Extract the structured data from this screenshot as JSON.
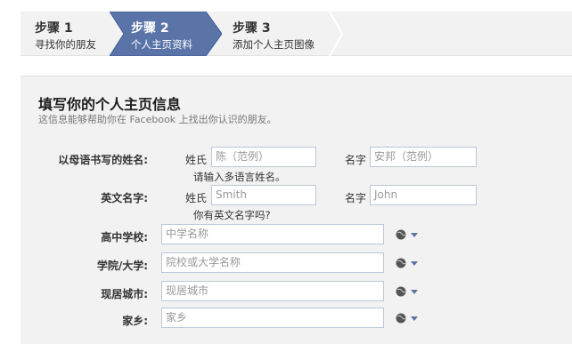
{
  "steps": [
    {
      "title": "步骤 1",
      "subtitle": "寻找你的朋友"
    },
    {
      "title": "步骤 2",
      "subtitle": "个人主页资料"
    },
    {
      "title": "步骤 3",
      "subtitle": "添加个人主页图像"
    }
  ],
  "colors": {
    "active_step": "#5b74a8",
    "input_border": "#bdc7d8",
    "panel_bg": "#f2f2f2"
  },
  "form": {
    "title": "填写你的个人主页信息",
    "subtitle": "这信息能够帮助你在 Facebook 上找出你认识的朋友。",
    "native_name": {
      "label": "以母语书写的姓名:",
      "surname_label": "姓氏",
      "surname_placeholder": "陈（范例）",
      "given_label": "名字",
      "given_placeholder": "安邦（范例）",
      "hint": "请输入多语言姓名。"
    },
    "english_name": {
      "label": "英文名字:",
      "surname_label": "姓氏",
      "surname_placeholder": "Smith",
      "given_label": "名字",
      "given_placeholder": "John",
      "hint": "你有英文名字吗?"
    },
    "high_school": {
      "label": "高中学校:",
      "placeholder": "中学名称"
    },
    "college": {
      "label": "学院/大学:",
      "placeholder": "院校或大学名称"
    },
    "current_city": {
      "label": "现居城市:",
      "placeholder": "现居城市"
    },
    "hometown": {
      "label": "家乡:",
      "placeholder": "家乡"
    },
    "privacy_icon": "globe-icon"
  }
}
